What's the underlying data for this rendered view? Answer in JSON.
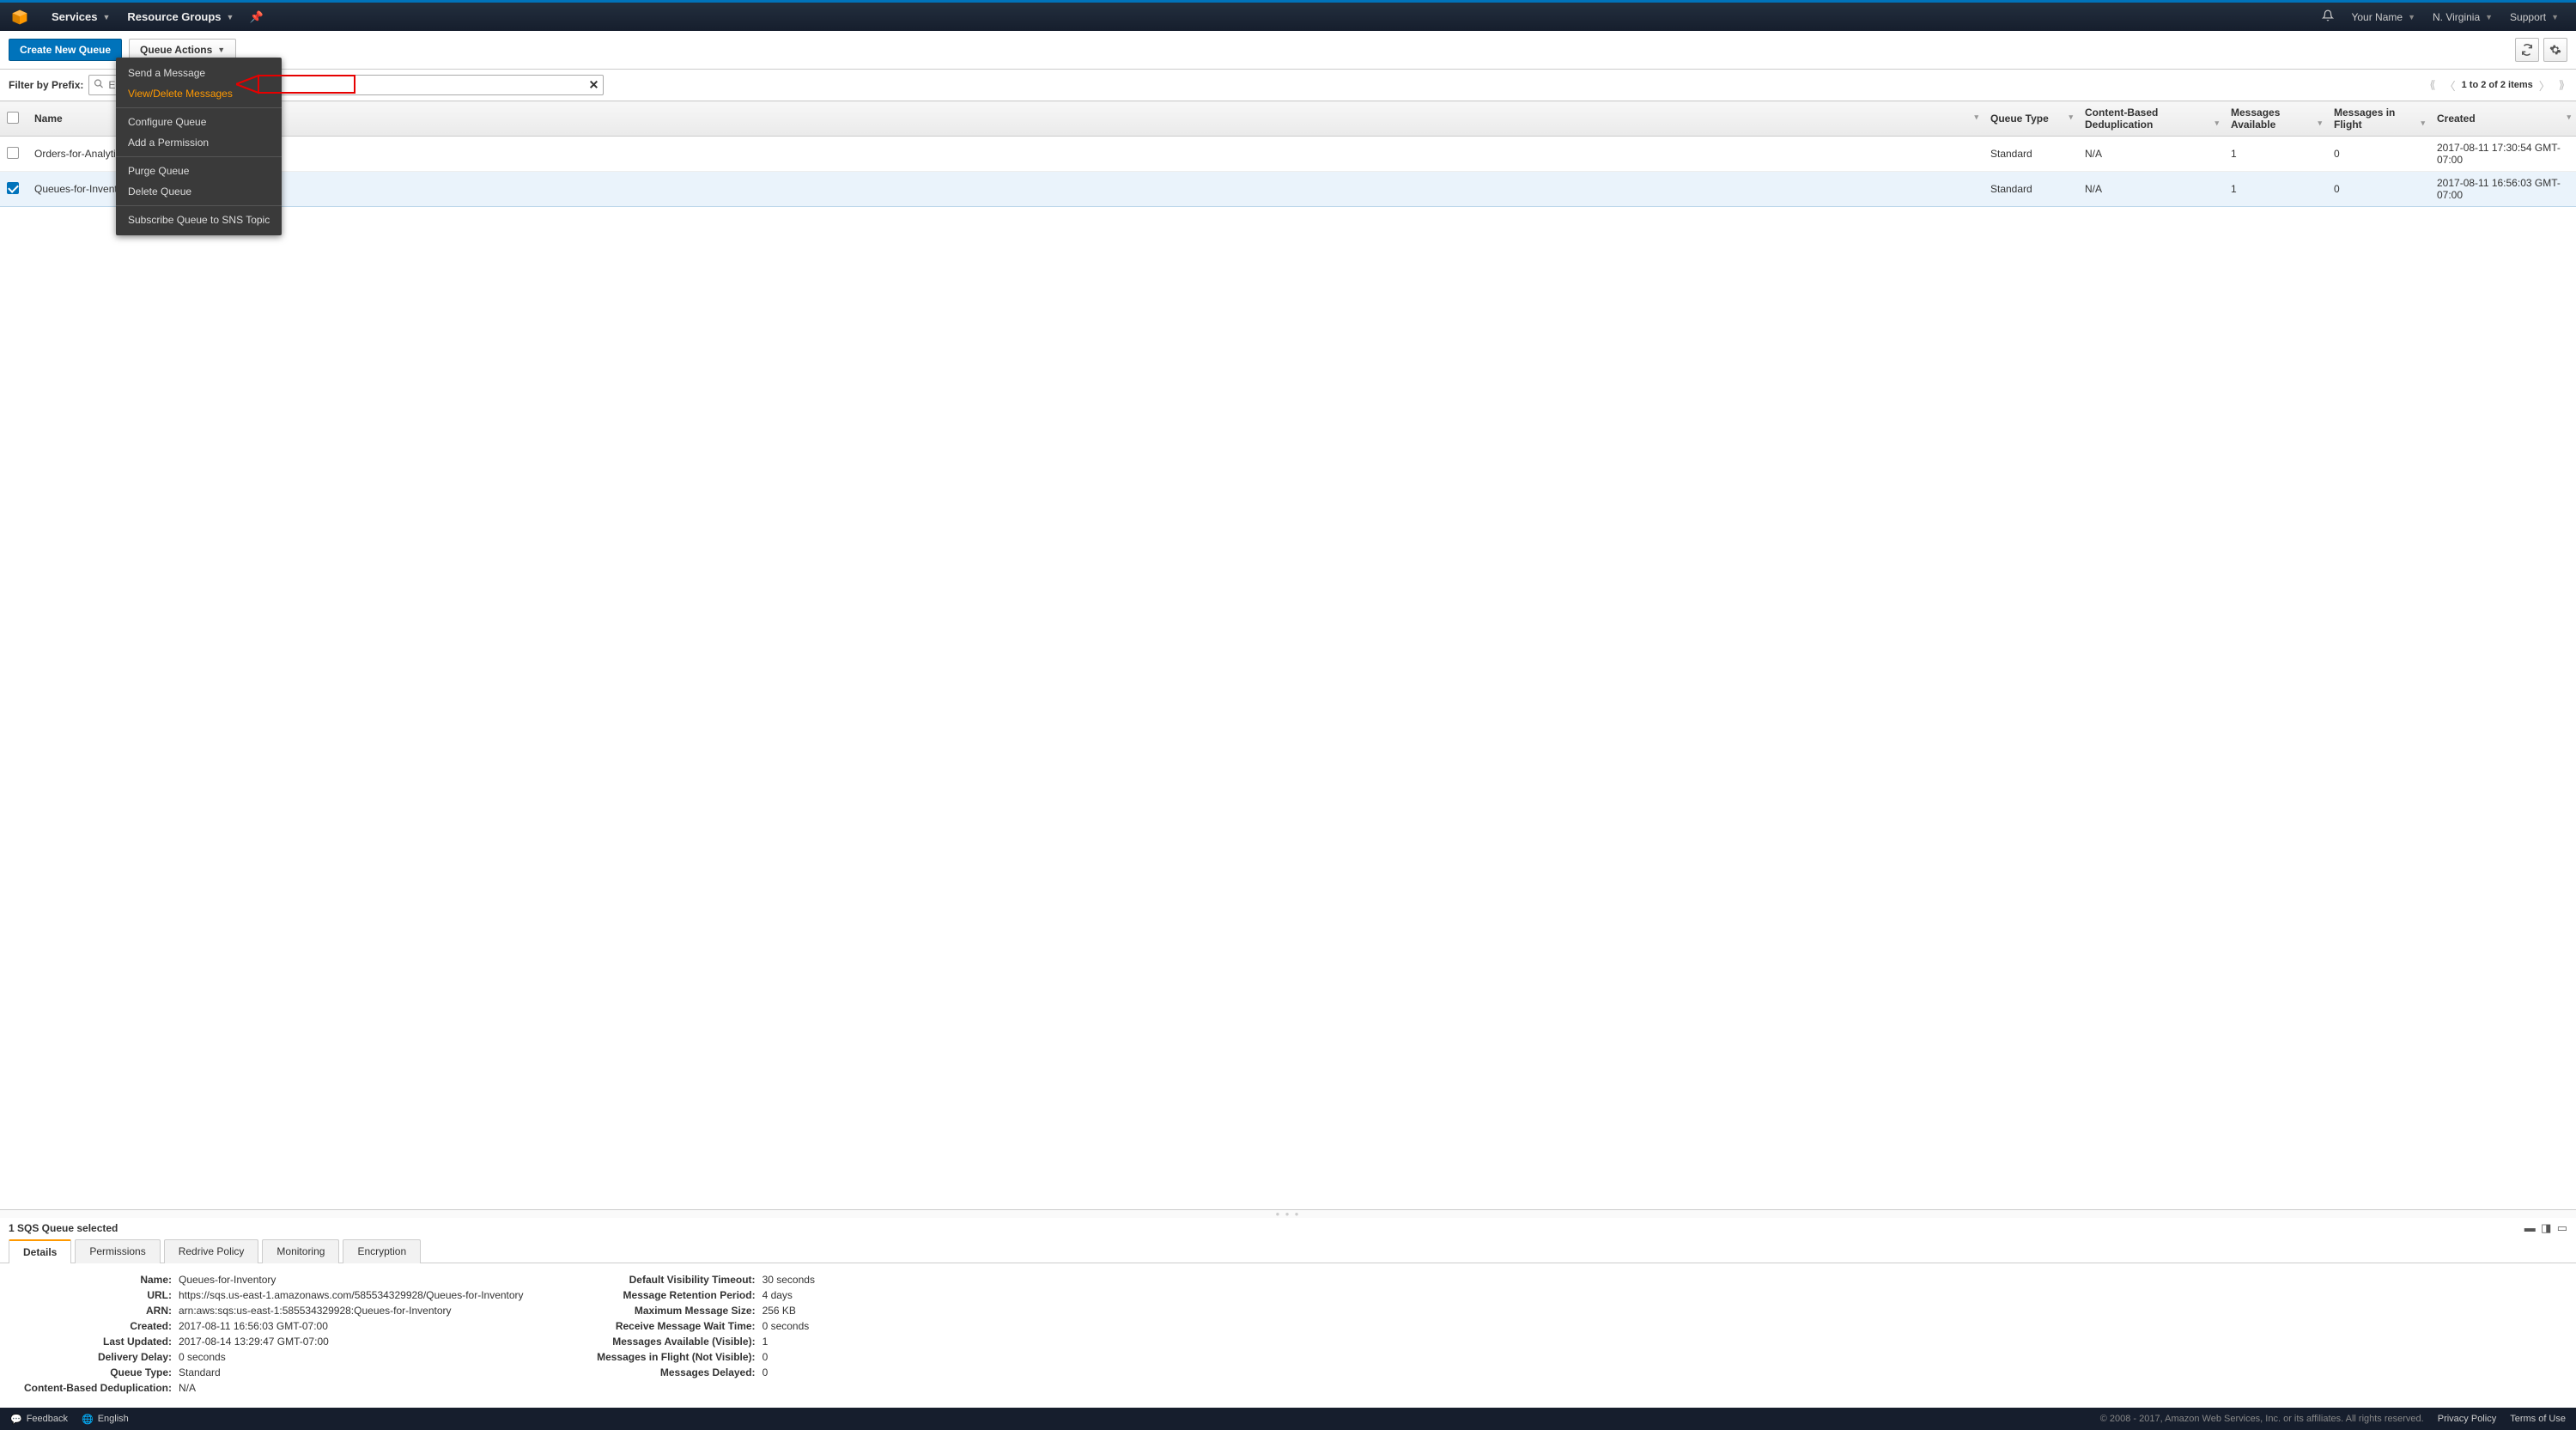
{
  "topnav": {
    "services": "Services",
    "resource_groups": "Resource Groups",
    "your_name": "Your Name",
    "region": "N. Virginia",
    "support": "Support"
  },
  "toolbar": {
    "create_queue": "Create New Queue",
    "queue_actions": "Queue Actions"
  },
  "dropdown": {
    "send_message": "Send a Message",
    "view_delete": "View/Delete Messages",
    "configure": "Configure Queue",
    "add_permission": "Add a Permission",
    "purge": "Purge Queue",
    "delete": "Delete Queue",
    "subscribe": "Subscribe Queue to SNS Topic"
  },
  "filter": {
    "label": "Filter by Prefix:",
    "placeholder": "Enter Text",
    "value": ""
  },
  "pager": {
    "text": "1 to 2 of 2 items"
  },
  "columns": {
    "name": "Name",
    "queue_type": "Queue Type",
    "dedup": "Content-Based Deduplication",
    "msg_avail": "Messages Available",
    "msg_flight": "Messages in Flight",
    "created": "Created"
  },
  "rows": [
    {
      "name": "Orders-for-Analytics",
      "queue_type": "Standard",
      "dedup": "N/A",
      "msg_avail": "1",
      "msg_flight": "0",
      "created": "2017-08-11 17:30:54 GMT-07:00",
      "selected": false
    },
    {
      "name": "Queues-for-Inventory",
      "queue_type": "Standard",
      "dedup": "N/A",
      "msg_avail": "1",
      "msg_flight": "0",
      "created": "2017-08-11 16:56:03 GMT-07:00",
      "selected": true
    }
  ],
  "panel": {
    "title": "1 SQS Queue selected",
    "tabs": {
      "details": "Details",
      "permissions": "Permissions",
      "redrive": "Redrive Policy",
      "monitoring": "Monitoring",
      "encryption": "Encryption"
    }
  },
  "details_left": {
    "name_k": "Name:",
    "name_v": "Queues-for-Inventory",
    "url_k": "URL:",
    "url_v": "https://sqs.us-east-1.amazonaws.com/585534329928/Queues-for-Inventory",
    "arn_k": "ARN:",
    "arn_v": "arn:aws:sqs:us-east-1:585534329928:Queues-for-Inventory",
    "created_k": "Created:",
    "created_v": "2017-08-11 16:56:03 GMT-07:00",
    "updated_k": "Last Updated:",
    "updated_v": "2017-08-14 13:29:47 GMT-07:00",
    "delay_k": "Delivery Delay:",
    "delay_v": "0 seconds",
    "qtype_k": "Queue Type:",
    "qtype_v": "Standard",
    "dedup_k": "Content-Based Deduplication:",
    "dedup_v": "N/A"
  },
  "details_right": {
    "vis_k": "Default Visibility Timeout:",
    "vis_v": "30 seconds",
    "ret_k": "Message Retention Period:",
    "ret_v": "4 days",
    "maxsize_k": "Maximum Message Size:",
    "maxsize_v": "256 KB",
    "wait_k": "Receive Message Wait Time:",
    "wait_v": "0 seconds",
    "avail_k": "Messages Available (Visible):",
    "avail_v": "1",
    "flight_k": "Messages in Flight (Not Visible):",
    "flight_v": "0",
    "delayed_k": "Messages Delayed:",
    "delayed_v": "0"
  },
  "footer": {
    "feedback": "Feedback",
    "english": "English",
    "copyright": "© 2008 - 2017, Amazon Web Services, Inc. or its affiliates. All rights reserved.",
    "privacy": "Privacy Policy",
    "terms": "Terms of Use"
  }
}
